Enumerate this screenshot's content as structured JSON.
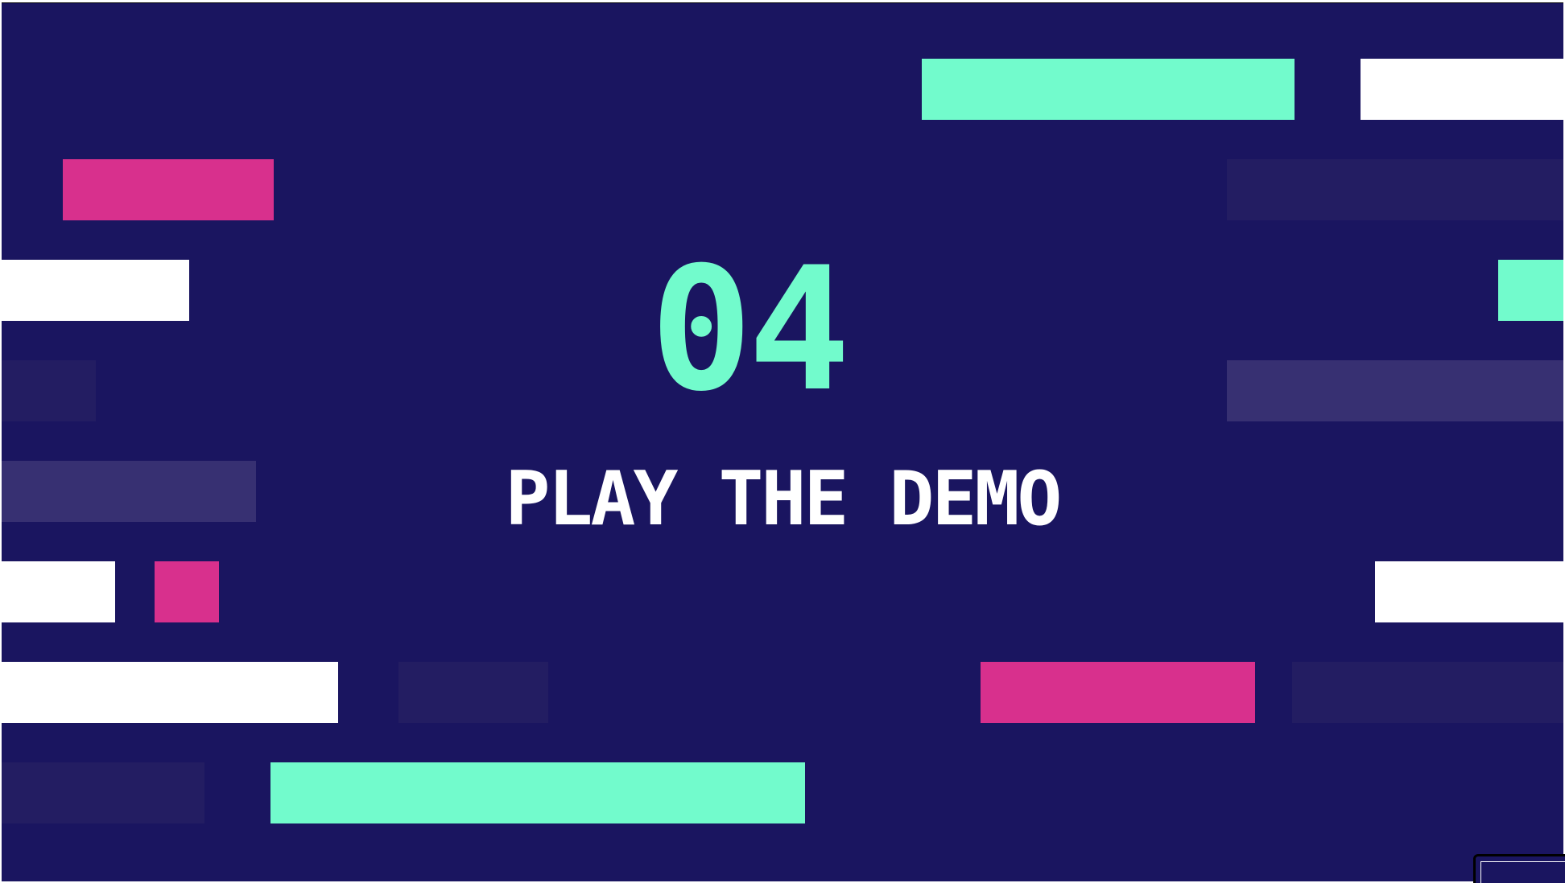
{
  "slide": {
    "number": "04",
    "title": "PLAY THE DEMO"
  },
  "colors": {
    "background": "#1a1560",
    "mint": "#72fbcc",
    "pink": "#d8308d",
    "white": "#ffffff",
    "faint": "#231d62",
    "muted": "#373072"
  }
}
